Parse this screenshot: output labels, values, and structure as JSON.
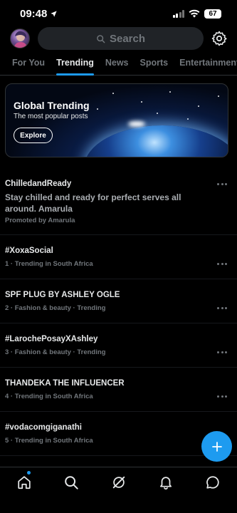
{
  "status_bar": {
    "time": "09:48",
    "battery": "67"
  },
  "header": {
    "search_placeholder": "Search"
  },
  "tabs": [
    {
      "label": "For You"
    },
    {
      "label": "Trending",
      "active": true
    },
    {
      "label": "News"
    },
    {
      "label": "Sports"
    },
    {
      "label": "Entertainment"
    }
  ],
  "banner": {
    "title": "Global Trending",
    "subtitle": "The most popular posts",
    "button_label": "Explore"
  },
  "promoted": {
    "title": "ChilledandReady",
    "description": "Stay chilled and ready for perfect serves all around. Amarula",
    "meta": "Promoted by Amarula"
  },
  "trends": [
    {
      "title": "#XoxaSocial",
      "meta": "1 · Trending in South Africa"
    },
    {
      "title": "SPF PLUG BY ASHLEY OGLE",
      "meta": "2 · Fashion & beauty · Trending"
    },
    {
      "title": "#LarochePosayXAshley",
      "meta": "3 · Fashion & beauty · Trending"
    },
    {
      "title": "THANDEKA THE INFLUENCER",
      "meta": "4 · Trending in South Africa"
    },
    {
      "title": "#vodacomgiganathi",
      "meta": "5 · Trending in South Africa"
    }
  ],
  "colors": {
    "accent": "#1d9bf0",
    "background": "#000000",
    "muted_text": "#71767b"
  },
  "icons": {
    "bottom_nav": [
      "home-icon",
      "search-icon",
      "grok-icon",
      "notifications-icon",
      "messages-icon"
    ],
    "fab": "plus-icon"
  }
}
